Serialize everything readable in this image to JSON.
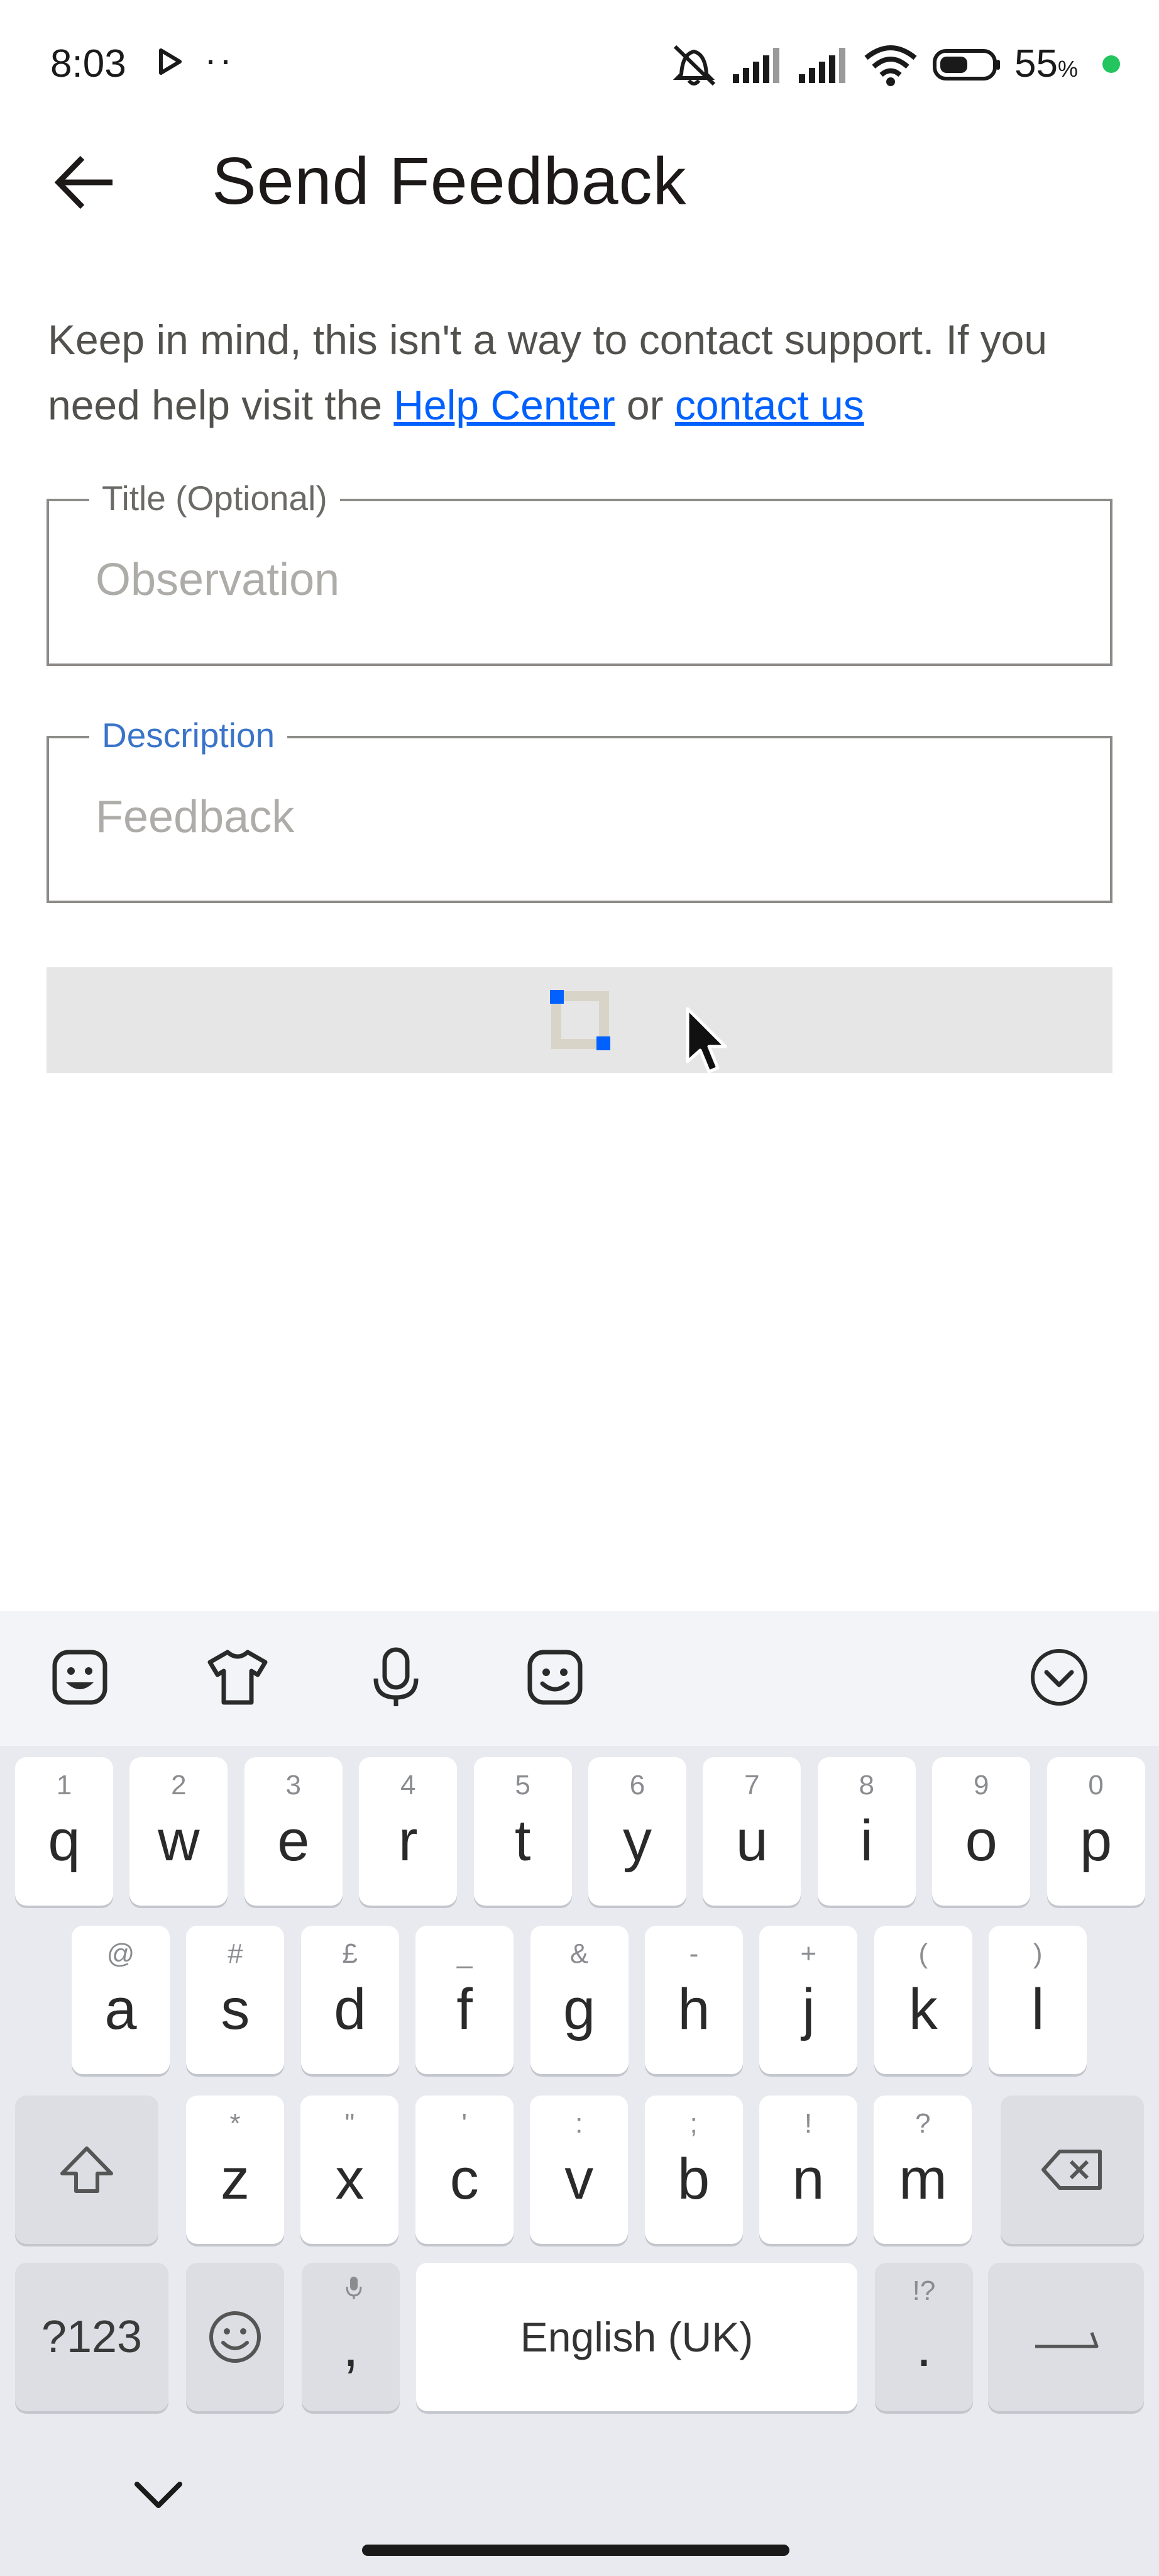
{
  "status_bar": {
    "time": "8:03",
    "dots": "··",
    "battery_percent": "55",
    "battery_percent_sign": "%",
    "battery_level": 0.55,
    "dot_color": "#22c55e"
  },
  "header": {
    "title": "Send Feedback",
    "back_icon": "arrow-left-icon"
  },
  "info": {
    "text_before": "Keep in mind, this isn't a way to contact support. If you need help visit the ",
    "help_link": "Help Center",
    "text_middle": " or ",
    "contact_link": "contact us",
    "link_color": "#0061fe"
  },
  "form": {
    "title_label": "Title (Optional)",
    "title_placeholder": "Observation",
    "title_value": "",
    "description_label": "Description",
    "description_placeholder": "Feedback",
    "description_value": "",
    "focused_label_color": "#3a74c9"
  },
  "keyboard": {
    "toolbar_icons": [
      "sticker-icon",
      "theme-shirt-icon",
      "microphone-icon",
      "emoji-face-icon",
      "collapse-chevron-icon"
    ],
    "row1": [
      {
        "key": "q",
        "hint": "1"
      },
      {
        "key": "w",
        "hint": "2"
      },
      {
        "key": "e",
        "hint": "3"
      },
      {
        "key": "r",
        "hint": "4"
      },
      {
        "key": "t",
        "hint": "5"
      },
      {
        "key": "y",
        "hint": "6"
      },
      {
        "key": "u",
        "hint": "7"
      },
      {
        "key": "i",
        "hint": "8"
      },
      {
        "key": "o",
        "hint": "9"
      },
      {
        "key": "p",
        "hint": "0"
      }
    ],
    "row2": [
      {
        "key": "a",
        "hint": "@"
      },
      {
        "key": "s",
        "hint": "#"
      },
      {
        "key": "d",
        "hint": "£"
      },
      {
        "key": "f",
        "hint": "_"
      },
      {
        "key": "g",
        "hint": "&"
      },
      {
        "key": "h",
        "hint": "-"
      },
      {
        "key": "j",
        "hint": "+"
      },
      {
        "key": "k",
        "hint": "("
      },
      {
        "key": "l",
        "hint": ")"
      }
    ],
    "row3": [
      {
        "key": "z",
        "hint": "*"
      },
      {
        "key": "x",
        "hint": "\""
      },
      {
        "key": "c",
        "hint": "'"
      },
      {
        "key": "v",
        "hint": ":"
      },
      {
        "key": "b",
        "hint": ";"
      },
      {
        "key": "n",
        "hint": "!"
      },
      {
        "key": "m",
        "hint": "?"
      }
    ],
    "symbols_label": "?123",
    "comma_label": ",",
    "space_label": "English (UK)",
    "period_label": ".",
    "period_hint": "!?"
  }
}
